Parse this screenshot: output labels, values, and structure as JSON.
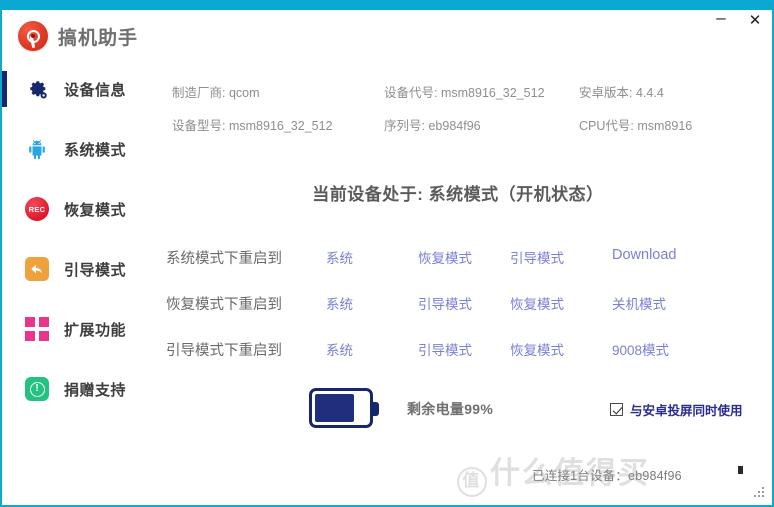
{
  "window": {
    "title": "搞机助手",
    "minimize_label": "–",
    "close_label": "✕",
    "accent_color": "#0aa9d2",
    "logo_icon": "target-logo-icon"
  },
  "sidebar": {
    "items": [
      {
        "label": "设备信息",
        "icon": "gear-icon",
        "active": true
      },
      {
        "label": "系统模式",
        "icon": "android-icon",
        "active": false
      },
      {
        "label": "恢复模式",
        "icon": "rec-icon",
        "badge": "REC",
        "active": false
      },
      {
        "label": "引导模式",
        "icon": "back-arrow-icon",
        "active": false
      },
      {
        "label": "扩展功能",
        "icon": "grid-icon",
        "active": false
      },
      {
        "label": "捐赠支持",
        "icon": "exclamation-circle-icon",
        "badge": "!",
        "active": false
      }
    ]
  },
  "device_info": {
    "rows": [
      [
        {
          "key": "制造厂商:",
          "value": "qcom"
        },
        {
          "key": "设备代号:",
          "value": "msm8916_32_512"
        },
        {
          "key": "安卓版本:",
          "value": "4.4.4"
        }
      ],
      [
        {
          "key": "设备型号:",
          "value": "msm8916_32_512"
        },
        {
          "key": "序列号:",
          "value": "eb984f96"
        },
        {
          "key": "CPU代号:",
          "value": "msm8916"
        }
      ]
    ]
  },
  "status": {
    "text": "当前设备处于: 系统模式（开机状态）"
  },
  "actions": {
    "rows": [
      {
        "label": "系统模式下重启到",
        "links": [
          "系统",
          "恢复模式",
          "引导模式",
          "Download"
        ]
      },
      {
        "label": "恢复模式下重启到",
        "links": [
          "系统",
          "引导模式",
          "恢复模式",
          "关机模式"
        ]
      },
      {
        "label": "引导模式下重启到",
        "links": [
          "系统",
          "引导模式",
          "恢复模式",
          "9008模式"
        ]
      }
    ],
    "link_color": "#7b7fd6"
  },
  "battery": {
    "icon": "battery-icon",
    "percent": 99,
    "label": "剩余电量99%",
    "fill_color": "#1f2f7e"
  },
  "checkbox": {
    "label": "与安卓投屏同时使用",
    "checked": true,
    "color": "#2a2a8f"
  },
  "footer": {
    "status": "已连接1台设备：eb984f96",
    "watermark": "什么值得买",
    "watermark_mark": "值",
    "resize_grip": "resize-grip-icon"
  }
}
